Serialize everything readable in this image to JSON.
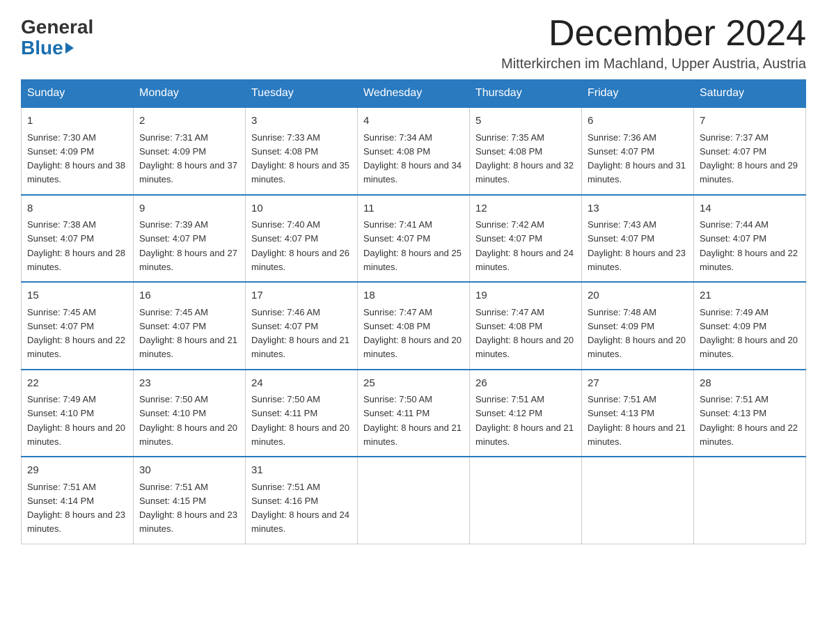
{
  "logo": {
    "general": "General",
    "blue": "Blue"
  },
  "header": {
    "month": "December 2024",
    "location": "Mitterkirchen im Machland, Upper Austria, Austria"
  },
  "days_of_week": [
    "Sunday",
    "Monday",
    "Tuesday",
    "Wednesday",
    "Thursday",
    "Friday",
    "Saturday"
  ],
  "weeks": [
    [
      {
        "day": "1",
        "sunrise": "7:30 AM",
        "sunset": "4:09 PM",
        "daylight": "8 hours and 38 minutes."
      },
      {
        "day": "2",
        "sunrise": "7:31 AM",
        "sunset": "4:09 PM",
        "daylight": "8 hours and 37 minutes."
      },
      {
        "day": "3",
        "sunrise": "7:33 AM",
        "sunset": "4:08 PM",
        "daylight": "8 hours and 35 minutes."
      },
      {
        "day": "4",
        "sunrise": "7:34 AM",
        "sunset": "4:08 PM",
        "daylight": "8 hours and 34 minutes."
      },
      {
        "day": "5",
        "sunrise": "7:35 AM",
        "sunset": "4:08 PM",
        "daylight": "8 hours and 32 minutes."
      },
      {
        "day": "6",
        "sunrise": "7:36 AM",
        "sunset": "4:07 PM",
        "daylight": "8 hours and 31 minutes."
      },
      {
        "day": "7",
        "sunrise": "7:37 AM",
        "sunset": "4:07 PM",
        "daylight": "8 hours and 29 minutes."
      }
    ],
    [
      {
        "day": "8",
        "sunrise": "7:38 AM",
        "sunset": "4:07 PM",
        "daylight": "8 hours and 28 minutes."
      },
      {
        "day": "9",
        "sunrise": "7:39 AM",
        "sunset": "4:07 PM",
        "daylight": "8 hours and 27 minutes."
      },
      {
        "day": "10",
        "sunrise": "7:40 AM",
        "sunset": "4:07 PM",
        "daylight": "8 hours and 26 minutes."
      },
      {
        "day": "11",
        "sunrise": "7:41 AM",
        "sunset": "4:07 PM",
        "daylight": "8 hours and 25 minutes."
      },
      {
        "day": "12",
        "sunrise": "7:42 AM",
        "sunset": "4:07 PM",
        "daylight": "8 hours and 24 minutes."
      },
      {
        "day": "13",
        "sunrise": "7:43 AM",
        "sunset": "4:07 PM",
        "daylight": "8 hours and 23 minutes."
      },
      {
        "day": "14",
        "sunrise": "7:44 AM",
        "sunset": "4:07 PM",
        "daylight": "8 hours and 22 minutes."
      }
    ],
    [
      {
        "day": "15",
        "sunrise": "7:45 AM",
        "sunset": "4:07 PM",
        "daylight": "8 hours and 22 minutes."
      },
      {
        "day": "16",
        "sunrise": "7:45 AM",
        "sunset": "4:07 PM",
        "daylight": "8 hours and 21 minutes."
      },
      {
        "day": "17",
        "sunrise": "7:46 AM",
        "sunset": "4:07 PM",
        "daylight": "8 hours and 21 minutes."
      },
      {
        "day": "18",
        "sunrise": "7:47 AM",
        "sunset": "4:08 PM",
        "daylight": "8 hours and 20 minutes."
      },
      {
        "day": "19",
        "sunrise": "7:47 AM",
        "sunset": "4:08 PM",
        "daylight": "8 hours and 20 minutes."
      },
      {
        "day": "20",
        "sunrise": "7:48 AM",
        "sunset": "4:09 PM",
        "daylight": "8 hours and 20 minutes."
      },
      {
        "day": "21",
        "sunrise": "7:49 AM",
        "sunset": "4:09 PM",
        "daylight": "8 hours and 20 minutes."
      }
    ],
    [
      {
        "day": "22",
        "sunrise": "7:49 AM",
        "sunset": "4:10 PM",
        "daylight": "8 hours and 20 minutes."
      },
      {
        "day": "23",
        "sunrise": "7:50 AM",
        "sunset": "4:10 PM",
        "daylight": "8 hours and 20 minutes."
      },
      {
        "day": "24",
        "sunrise": "7:50 AM",
        "sunset": "4:11 PM",
        "daylight": "8 hours and 20 minutes."
      },
      {
        "day": "25",
        "sunrise": "7:50 AM",
        "sunset": "4:11 PM",
        "daylight": "8 hours and 21 minutes."
      },
      {
        "day": "26",
        "sunrise": "7:51 AM",
        "sunset": "4:12 PM",
        "daylight": "8 hours and 21 minutes."
      },
      {
        "day": "27",
        "sunrise": "7:51 AM",
        "sunset": "4:13 PM",
        "daylight": "8 hours and 21 minutes."
      },
      {
        "day": "28",
        "sunrise": "7:51 AM",
        "sunset": "4:13 PM",
        "daylight": "8 hours and 22 minutes."
      }
    ],
    [
      {
        "day": "29",
        "sunrise": "7:51 AM",
        "sunset": "4:14 PM",
        "daylight": "8 hours and 23 minutes."
      },
      {
        "day": "30",
        "sunrise": "7:51 AM",
        "sunset": "4:15 PM",
        "daylight": "8 hours and 23 minutes."
      },
      {
        "day": "31",
        "sunrise": "7:51 AM",
        "sunset": "4:16 PM",
        "daylight": "8 hours and 24 minutes."
      },
      null,
      null,
      null,
      null
    ]
  ]
}
